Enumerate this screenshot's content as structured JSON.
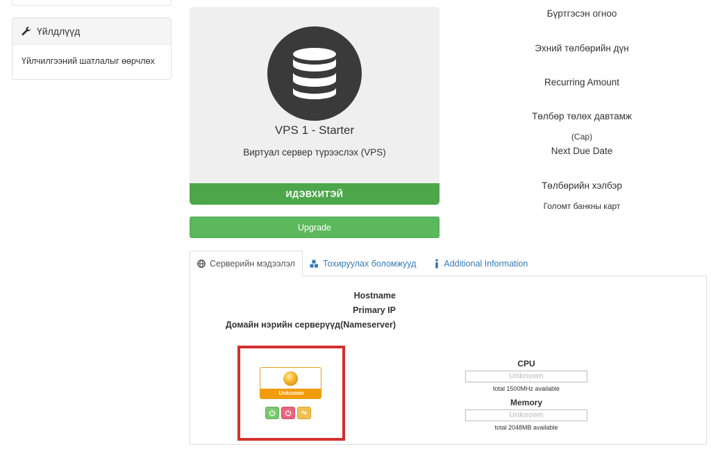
{
  "sidebar": {
    "actions_card": {
      "title": "Үйлдлүүд",
      "title_icon": "wrench-icon",
      "items": [
        {
          "label": "Үйлчилгээний шатлалыг өөрчлөх"
        }
      ]
    }
  },
  "product": {
    "icon": "database-icon",
    "name": "VPS 1 - Starter",
    "group": "Виртуал сервер түрээслэх (VPS)",
    "status": "ИДЭВХИТЭЙ",
    "status_color": "#4da74a",
    "upgrade_label": "Upgrade"
  },
  "billing": {
    "registration_date_label": "Бүртгэсэн огноо",
    "first_payment_label": "Эхний төлбөрийн дүн",
    "recurring_amount_label": "Recurring Amount",
    "billing_cycle_label": "Төлбөр төлөх давтамж",
    "billing_cycle_value": "(Сар)",
    "next_due_date_label": "Next Due Date",
    "payment_method_label": "Төлбөрийн хэлбэр",
    "payment_method_value": "Голомт банкны карт"
  },
  "tabs": [
    {
      "label": "Серверийн мэдээлэл",
      "icon": "globe-icon",
      "active": true
    },
    {
      "label": "Тохируулах боломжууд",
      "icon": "cubes-icon",
      "active": false
    },
    {
      "label": "Additional Information",
      "icon": "info-icon",
      "active": false
    }
  ],
  "server_info": {
    "hostname_label": "Hostname",
    "primary_ip_label": "Primary IP",
    "nameservers_label": "Домайн нэрийн серверүүд(Nameserver)"
  },
  "control": {
    "status": "Unknown",
    "status_color": "#f29b0c",
    "buttons": [
      "power-on-icon",
      "power-off-icon",
      "reboot-icon"
    ]
  },
  "resources": {
    "cpu": {
      "title": "CPU",
      "value": "Unknown",
      "sub": "total 1500MHz available"
    },
    "memory": {
      "title": "Memory",
      "value": "Unknown",
      "sub": "total 2048MB available"
    }
  }
}
